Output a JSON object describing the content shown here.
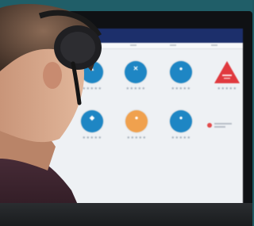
{
  "scene": {
    "background_color": "#205e68",
    "screen_header_color": "#1c2f6b",
    "accent_blue": "#1e86c4",
    "accent_orange": "#f0a14e",
    "alert_red": "#e0393e"
  },
  "dashboard": {
    "tiles": [
      {
        "icon": "blue-circle-icon",
        "glyph": "▲"
      },
      {
        "icon": "blue-circle-icon",
        "glyph": "✕"
      },
      {
        "icon": "blue-circle-icon",
        "glyph": "●"
      },
      {
        "icon": "red-triangle-alert-icon",
        "glyph": ""
      },
      {
        "icon": "blue-circle-icon",
        "glyph": "◆"
      },
      {
        "icon": "orange-circle-icon",
        "glyph": "●"
      },
      {
        "icon": "blue-circle-icon",
        "glyph": "●"
      }
    ],
    "star_rating_text": "★★★★★"
  }
}
